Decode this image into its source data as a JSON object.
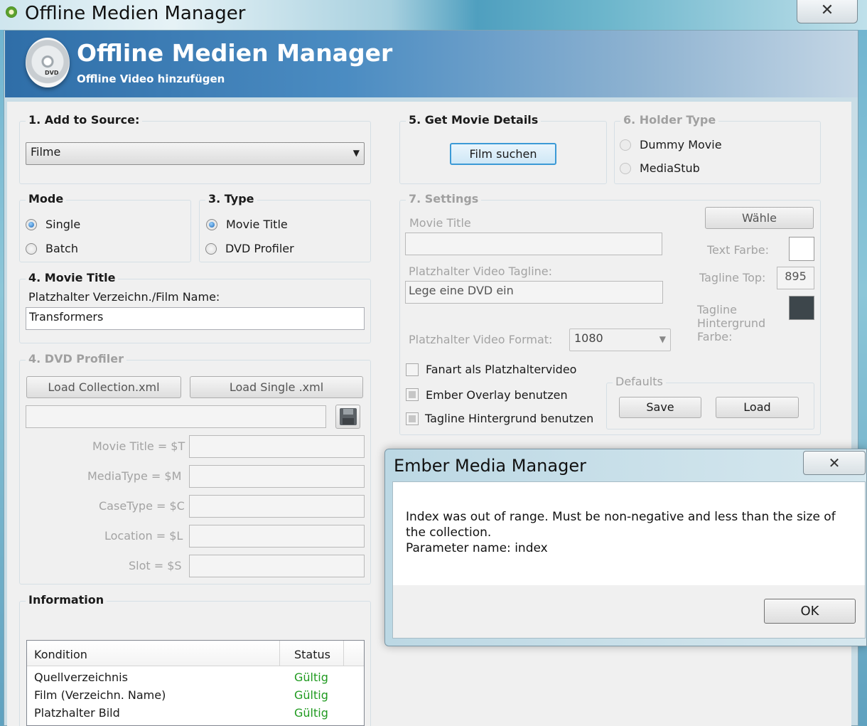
{
  "window": {
    "title": "Offline Medien Manager",
    "close_label": "✕"
  },
  "banner": {
    "title": "Offline Medien Manager",
    "subtitle": "Offline Video hinzufügen",
    "logo_text": "DVD"
  },
  "source": {
    "legend": "1. Add to Source:",
    "selected": "Filme"
  },
  "mode": {
    "legend": "Mode",
    "options": [
      "Single",
      "Batch"
    ],
    "selected": "Single"
  },
  "type": {
    "legend": "3. Type",
    "options": [
      "Movie Title",
      "DVD Profiler"
    ],
    "selected": "Movie Title"
  },
  "movie_title": {
    "legend": "4. Movie Title",
    "label": "Platzhalter Verzeichn./Film Name:",
    "value": "Transformers"
  },
  "dvd_profiler": {
    "legend": "4. DVD Profiler",
    "load_collection": "Load Collection.xml",
    "load_single": "Load Single .xml",
    "path_value": "",
    "fields": [
      {
        "label": "Movie Title = $T",
        "value": ""
      },
      {
        "label": "MediaType = $M",
        "value": ""
      },
      {
        "label": "CaseType = $C",
        "value": ""
      },
      {
        "label": "Location = $L",
        "value": ""
      },
      {
        "label": "Slot = $S",
        "value": ""
      }
    ]
  },
  "information": {
    "legend": "Information",
    "columns": [
      "Kondition",
      "Status"
    ],
    "rows": [
      {
        "condition": "Quellverzeichnis",
        "status": "Gültig"
      },
      {
        "condition": "Film (Verzeichn. Name)",
        "status": "Gültig"
      },
      {
        "condition": "Platzhalter Bild",
        "status": "Gültig"
      }
    ]
  },
  "get_details": {
    "legend": "5. Get Movie Details",
    "button": "Film suchen"
  },
  "holder_type": {
    "legend": "6. Holder Type",
    "options": [
      "Dummy Movie",
      "MediaStub"
    ]
  },
  "settings": {
    "legend": "7. Settings",
    "movie_title_label": "Movie Title",
    "movie_title_value": "",
    "tagline_label": "Platzhalter Video Tagline:",
    "tagline_value": "Lege eine DVD ein",
    "format_label": "Platzhalter Video Format:",
    "format_value": "1080",
    "choose_button": "Wähle",
    "text_color_label": "Text Farbe:",
    "text_color": "#ffffff",
    "tagline_top_label": "Tagline Top:",
    "tagline_top_value": "895",
    "tagline_bg_label": "Tagline Hintergrund Farbe:",
    "tagline_bg_color": "#3d464b",
    "checkboxes": [
      {
        "label": "Fanart als Platzhaltervideo",
        "checked": false
      },
      {
        "label": "Ember Overlay benutzen",
        "checked": true
      },
      {
        "label": "Tagline Hintergrund benutzen",
        "checked": true
      }
    ],
    "defaults": {
      "legend": "Defaults",
      "save": "Save",
      "load": "Load"
    }
  },
  "dialog": {
    "title": "Ember Media Manager",
    "close_label": "✕",
    "message": "Index was out of range. Must be non-negative and less than the size of the collection.\nParameter name: index",
    "ok": "OK"
  }
}
